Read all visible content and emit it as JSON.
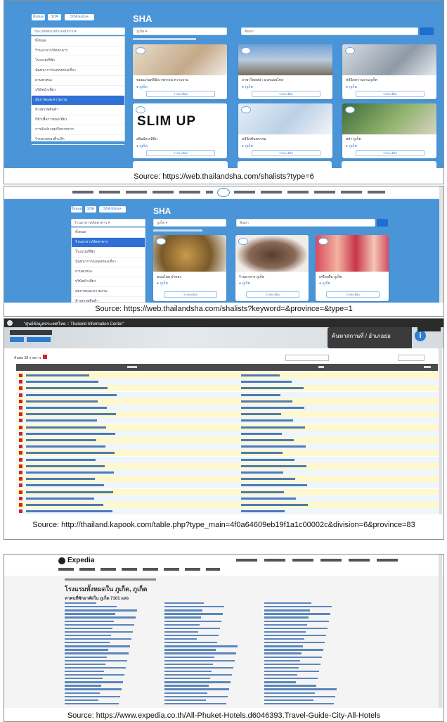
{
  "panels": [
    {
      "id": "sha-type6",
      "heading": "SHA",
      "caption": "Source: https://web.thailandsha.com/shalists?type=6",
      "brand_text": "SLIM UP"
    },
    {
      "id": "sha-type1",
      "heading": "SHA",
      "caption": "Source: https://web.thailandsha.com/shalists?keyword=&province=&type=1"
    },
    {
      "id": "kapook-table",
      "tab_title": "\"ศูนย์ข้อมูลประเทศไทย :: Thailand Information Center\"",
      "map_label": "ค้นหาสถานที่ / อำเภอย่อ",
      "caption": "Source: http://thailand.kapook.com/table.php?type_main=4f0a64609eb19f1a1c00002c&division=6&province=83"
    },
    {
      "id": "expedia-phuket",
      "brand": "Expedia",
      "caption": "Source: https://www.expedia.co.th/All-Phuket-Hotels.d6046393.Travel-Guide-City-All-Hotels"
    }
  ],
  "colors": {
    "sha_blue": "#4a95d8",
    "selected_blue": "#2f6fd6",
    "kapook_red": "#d2232a",
    "row_yellow": "#fff8cc",
    "link_blue": "#2c5e9e"
  }
}
